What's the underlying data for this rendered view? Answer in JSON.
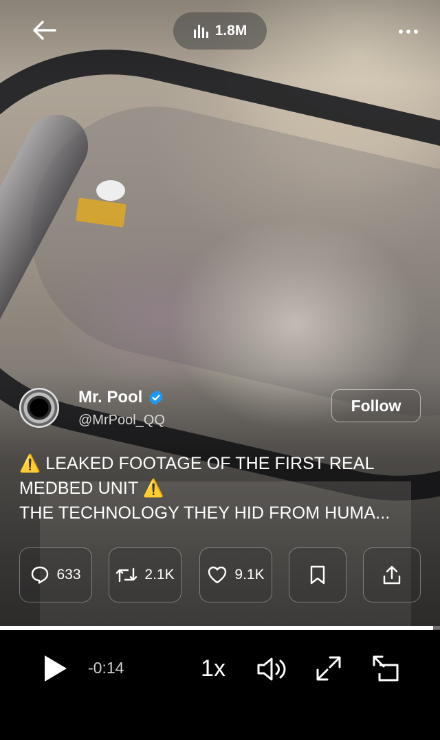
{
  "header": {
    "views": "1.8M"
  },
  "author": {
    "name": "Mr. Pool",
    "handle": "@MrPool_QQ",
    "follow_label": "Follow"
  },
  "tweet": {
    "line1": "⚠️ LEAKED FOOTAGE OF THE FIRST REAL",
    "line2": "MEDBED UNIT ⚠️",
    "line3": "THE TECHNOLOGY THEY HID FROM HUMA..."
  },
  "actions": {
    "replies": "633",
    "reposts": "2.1K",
    "likes": "9.1K"
  },
  "player": {
    "progress": 0.985,
    "time_remaining": "-0:14",
    "speed": "1x"
  },
  "colors": {
    "verified": "#1d9bf0",
    "background": "#000000"
  },
  "icons": [
    "back-arrow-icon",
    "views-chart-icon",
    "more-icon",
    "verified-badge-icon",
    "reply-icon",
    "repost-icon",
    "like-icon",
    "bookmark-icon",
    "share-icon",
    "play-icon",
    "volume-icon",
    "fullscreen-icon",
    "popout-icon"
  ]
}
